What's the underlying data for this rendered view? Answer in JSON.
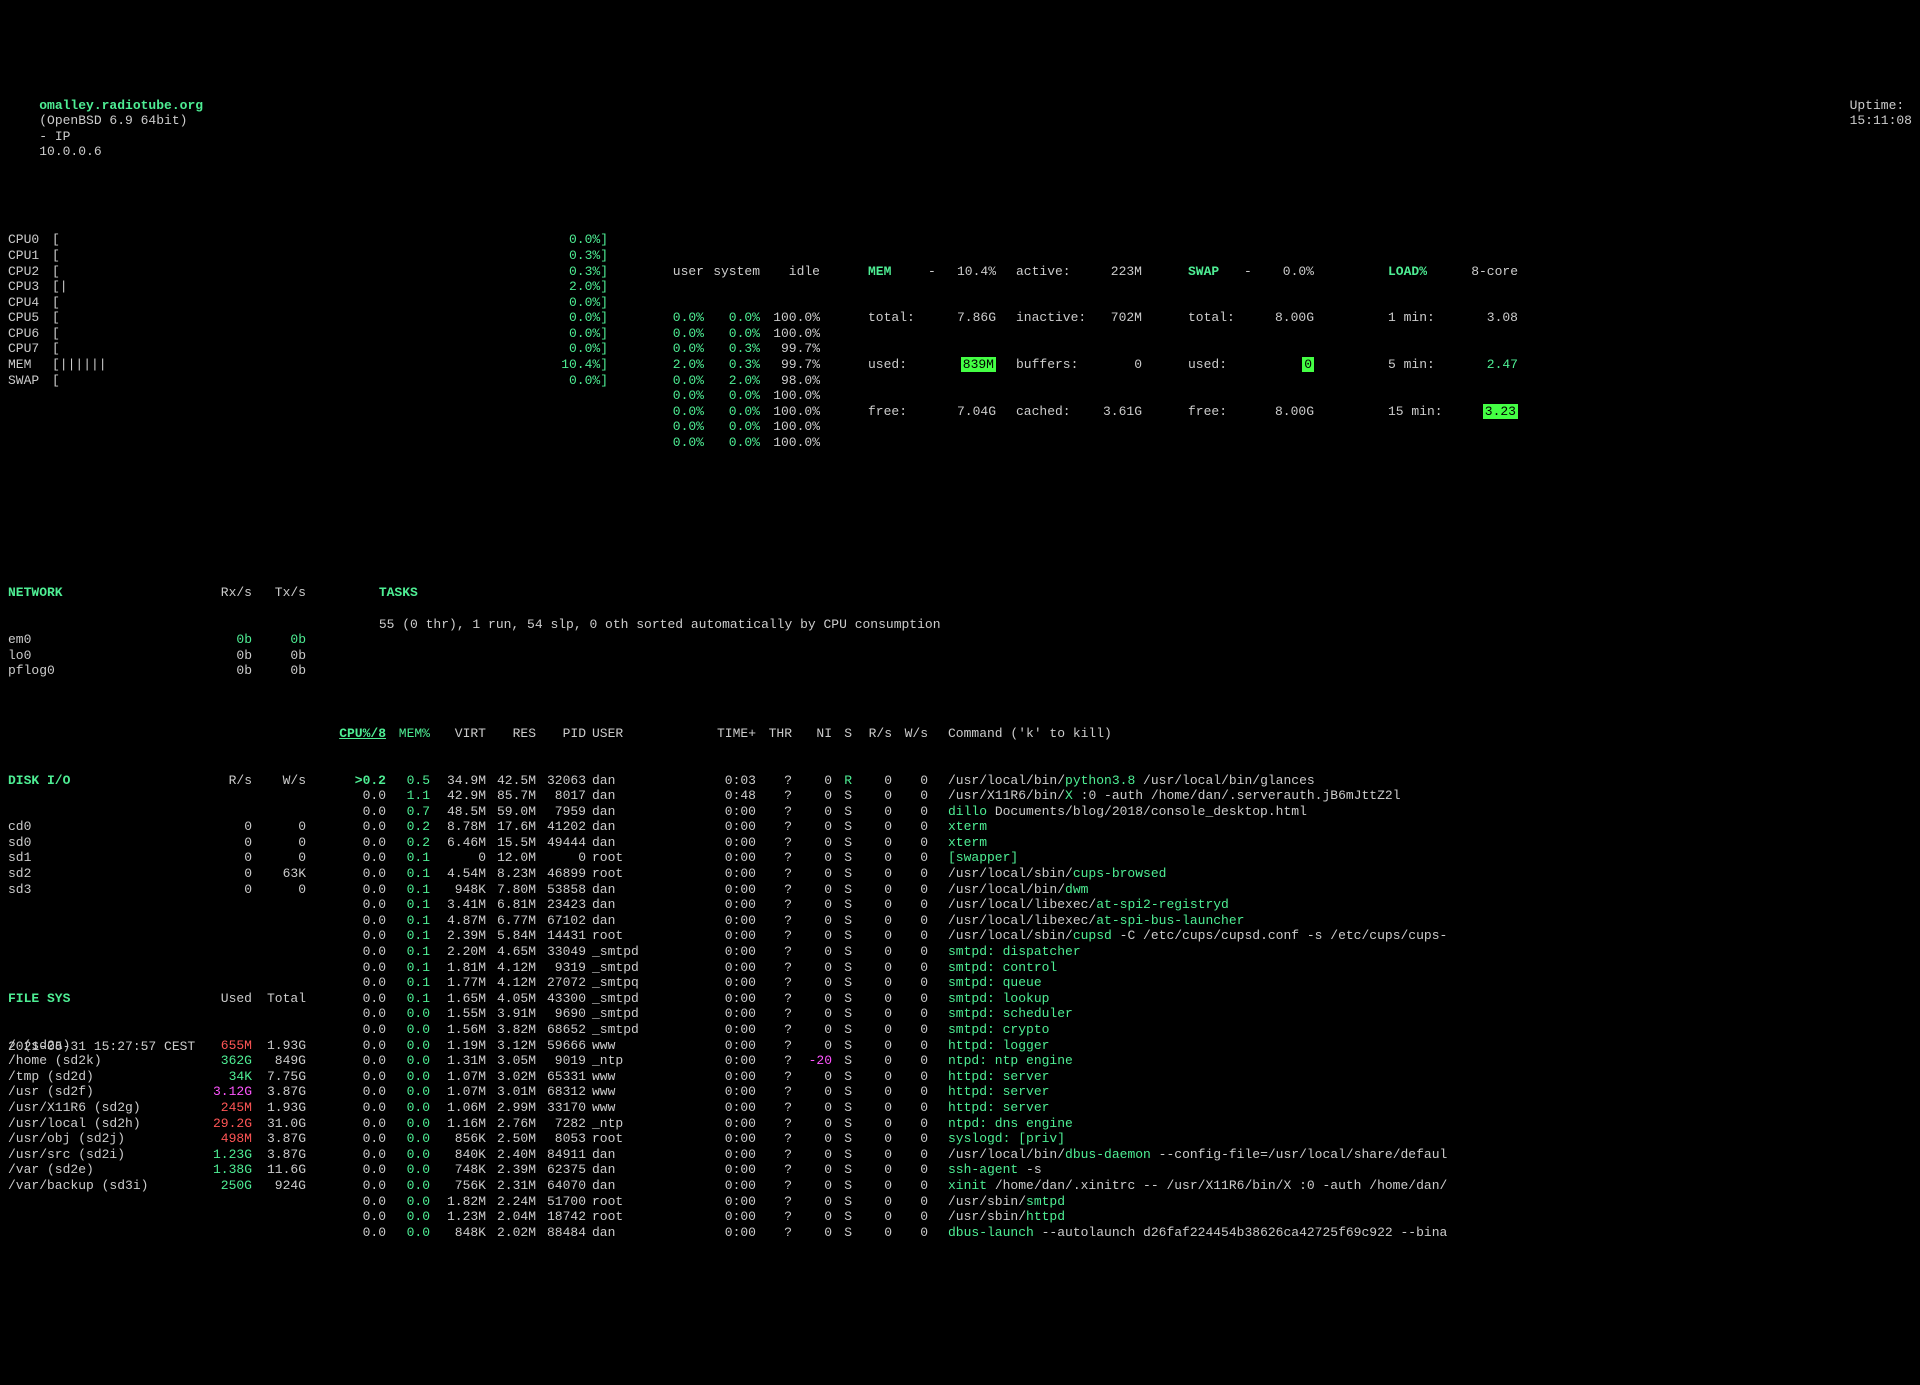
{
  "header": {
    "hostname": "omalley.radiotube.org",
    "os": "(OpenBSD 6.9 64bit)",
    "ip_label": "- IP",
    "ip": "10.0.0.6",
    "uptime_label": "Uptime:",
    "uptime": "15:11:08"
  },
  "cpus": [
    {
      "label": "CPU0",
      "bar": "[",
      "pct": "0.0%]"
    },
    {
      "label": "CPU1",
      "bar": "[",
      "pct": "0.3%]"
    },
    {
      "label": "CPU2",
      "bar": "[",
      "pct": "0.3%]"
    },
    {
      "label": "CPU3",
      "bar": "[|",
      "pct": "2.0%]"
    },
    {
      "label": "CPU4",
      "bar": "[",
      "pct": "0.0%]"
    },
    {
      "label": "CPU5",
      "bar": "[",
      "pct": "0.0%]"
    },
    {
      "label": "CPU6",
      "bar": "[",
      "pct": "0.0%]"
    },
    {
      "label": "CPU7",
      "bar": "[",
      "pct": "0.0%]"
    },
    {
      "label": "MEM ",
      "bar": "[||||||",
      "pct": "10.4%]"
    },
    {
      "label": "SWAP",
      "bar": "[",
      "pct": "0.0%]"
    }
  ],
  "usi_head": {
    "u": "user",
    "s": "system",
    "i": "idle"
  },
  "usi": [
    {
      "u": "0.0%",
      "s": "0.0%",
      "i": "100.0%"
    },
    {
      "u": "0.0%",
      "s": "0.0%",
      "i": "100.0%"
    },
    {
      "u": "0.0%",
      "s": "0.3%",
      "i": "99.7%"
    },
    {
      "u": "2.0%",
      "s": "0.3%",
      "i": "99.7%"
    },
    {
      "u": "0.0%",
      "s": "2.0%",
      "i": "98.0%"
    },
    {
      "u": "0.0%",
      "s": "0.0%",
      "i": "100.0%"
    },
    {
      "u": "0.0%",
      "s": "0.0%",
      "i": "100.0%"
    },
    {
      "u": "0.0%",
      "s": "0.0%",
      "i": "100.0%"
    },
    {
      "u": "0.0%",
      "s": "0.0%",
      "i": "100.0%"
    }
  ],
  "mem": {
    "title": "MEM",
    "dash": "-",
    "pct": "10.4%",
    "active_l": "active:",
    "active_v": "223M",
    "total_l": "total:",
    "total_v": "7.86G",
    "inactive_l": "inactive:",
    "inactive_v": "702M",
    "used_l": "used:",
    "used_v": "839M",
    "buffers_l": "buffers:",
    "buffers_v": "0",
    "free_l": "free:",
    "free_v": "7.04G",
    "cached_l": "cached:",
    "cached_v": "3.61G"
  },
  "swap": {
    "title": "SWAP",
    "dash": "-",
    "pct": "0.0%",
    "total_l": "total:",
    "total_v": "8.00G",
    "used_l": "used:",
    "used_v": "0",
    "free_l": "free:",
    "free_v": "8.00G"
  },
  "load": {
    "title": "LOAD%",
    "core": "8-core",
    "m1_l": "1 min:",
    "m1_v": "3.08",
    "m5_l": "5 min:",
    "m5_v": "2.47",
    "m15_l": "15 min:",
    "m15_v": "3.23"
  },
  "network": {
    "title": "NETWORK",
    "rx": "Rx/s",
    "tx": "Tx/s",
    "rows": [
      {
        "if": "em0",
        "rx": "0b",
        "tx": "0b",
        "c": "green"
      },
      {
        "if": "lo0",
        "rx": "0b",
        "tx": "0b",
        "c": "white"
      },
      {
        "if": "pflog0",
        "rx": "0b",
        "tx": "0b",
        "c": "white"
      }
    ]
  },
  "diskio": {
    "title": "DISK I/O",
    "r": "R/s",
    "w": "W/s",
    "rows": [
      {
        "d": "cd0",
        "r": "0",
        "w": "0"
      },
      {
        "d": "sd0",
        "r": "0",
        "w": "0"
      },
      {
        "d": "sd1",
        "r": "0",
        "w": "0"
      },
      {
        "d": "sd2",
        "r": "0",
        "w": "63K"
      },
      {
        "d": "sd3",
        "r": "0",
        "w": "0"
      }
    ]
  },
  "filesys": {
    "title": "FILE SYS",
    "used": "Used",
    "total": "Total",
    "rows": [
      {
        "p": "/ (sd2a)",
        "u": "655M",
        "t": "1.93G",
        "c": "red"
      },
      {
        "p": "/home (sd2k)",
        "u": "362G",
        "t": "849G",
        "c": "green"
      },
      {
        "p": "/tmp (sd2d)",
        "u": "34K",
        "t": "7.75G",
        "c": "green"
      },
      {
        "p": "/usr (sd2f)",
        "u": "3.12G",
        "t": "3.87G",
        "c": "magenta"
      },
      {
        "p": "/usr/X11R6 (sd2g)",
        "u": "245M",
        "t": "1.93G",
        "c": "red"
      },
      {
        "p": "/usr/local (sd2h)",
        "u": "29.2G",
        "t": "31.0G",
        "c": "red"
      },
      {
        "p": "/usr/obj (sd2j)",
        "u": "498M",
        "t": "3.87G",
        "c": "red"
      },
      {
        "p": "/usr/src (sd2i)",
        "u": "1.23G",
        "t": "3.87G",
        "c": "green"
      },
      {
        "p": "/var (sd2e)",
        "u": "1.38G",
        "t": "11.6G",
        "c": "green"
      },
      {
        "p": "/var/backup (sd3i)",
        "u": "250G",
        "t": "924G",
        "c": "green"
      }
    ]
  },
  "tasks_label": "TASKS",
  "tasks_text": "55 (0 thr), 1 run, 54 slp, 0 oth sorted automatically by CPU consumption",
  "proc_head": {
    "cpu": "CPU%/8",
    "mem": "MEM%",
    "virt": "VIRT",
    "res": "RES",
    "pid": "PID",
    "user": "USER",
    "time": "TIME+",
    "thr": "THR",
    "ni": "NI",
    "s": "S",
    "rs": "R/s",
    "ws": "W/s",
    "cmd": "Command ('k' to kill)"
  },
  "procs": [
    {
      "cpu": ">0.2",
      "mem": "0.5",
      "virt": "34.9M",
      "res": "42.5M",
      "pid": "32063",
      "user": "dan",
      "time": "0:03",
      "thr": "?",
      "ni": "0",
      "s": "R",
      "rs": "0",
      "ws": "0",
      "cmd": [
        {
          "t": "/usr/local/bin/",
          "c": "white"
        },
        {
          "t": "python3.8",
          "c": "green"
        },
        {
          "t": " /usr/local/bin/glances",
          "c": "white"
        }
      ]
    },
    {
      "cpu": "0.0",
      "mem": "1.1",
      "virt": "42.9M",
      "res": "85.7M",
      "pid": "8017",
      "user": "dan",
      "time": "0:48",
      "thr": "?",
      "ni": "0",
      "s": "S",
      "rs": "0",
      "ws": "0",
      "cmd": [
        {
          "t": "/usr/X11R6/bin/",
          "c": "white"
        },
        {
          "t": "X",
          "c": "green"
        },
        {
          "t": " :0 -auth /home/dan/.serverauth.jB6mJttZ2l",
          "c": "white"
        }
      ]
    },
    {
      "cpu": "0.0",
      "mem": "0.7",
      "virt": "48.5M",
      "res": "59.0M",
      "pid": "7959",
      "user": "dan",
      "time": "0:00",
      "thr": "?",
      "ni": "0",
      "s": "S",
      "rs": "0",
      "ws": "0",
      "cmd": [
        {
          "t": "dillo",
          "c": "green"
        },
        {
          "t": " Documents/blog/2018/console_desktop.html",
          "c": "white"
        }
      ]
    },
    {
      "cpu": "0.0",
      "mem": "0.2",
      "virt": "8.78M",
      "res": "17.6M",
      "pid": "41202",
      "user": "dan",
      "time": "0:00",
      "thr": "?",
      "ni": "0",
      "s": "S",
      "rs": "0",
      "ws": "0",
      "cmd": [
        {
          "t": "xterm",
          "c": "green"
        }
      ]
    },
    {
      "cpu": "0.0",
      "mem": "0.2",
      "virt": "6.46M",
      "res": "15.5M",
      "pid": "49444",
      "user": "dan",
      "time": "0:00",
      "thr": "?",
      "ni": "0",
      "s": "S",
      "rs": "0",
      "ws": "0",
      "cmd": [
        {
          "t": "xterm",
          "c": "green"
        }
      ]
    },
    {
      "cpu": "0.0",
      "mem": "0.1",
      "virt": "0",
      "res": "12.0M",
      "pid": "0",
      "user": "root",
      "time": "0:00",
      "thr": "?",
      "ni": "0",
      "s": "S",
      "rs": "0",
      "ws": "0",
      "cmd": [
        {
          "t": "[swapper]",
          "c": "green"
        }
      ]
    },
    {
      "cpu": "0.0",
      "mem": "0.1",
      "virt": "4.54M",
      "res": "8.23M",
      "pid": "46899",
      "user": "root",
      "time": "0:00",
      "thr": "?",
      "ni": "0",
      "s": "S",
      "rs": "0",
      "ws": "0",
      "cmd": [
        {
          "t": "/usr/local/sbin/",
          "c": "white"
        },
        {
          "t": "cups-browsed",
          "c": "green"
        }
      ]
    },
    {
      "cpu": "0.0",
      "mem": "0.1",
      "virt": "948K",
      "res": "7.80M",
      "pid": "53858",
      "user": "dan",
      "time": "0:00",
      "thr": "?",
      "ni": "0",
      "s": "S",
      "rs": "0",
      "ws": "0",
      "cmd": [
        {
          "t": "/usr/local/bin/",
          "c": "white"
        },
        {
          "t": "dwm",
          "c": "green"
        }
      ]
    },
    {
      "cpu": "0.0",
      "mem": "0.1",
      "virt": "3.41M",
      "res": "6.81M",
      "pid": "23423",
      "user": "dan",
      "time": "0:00",
      "thr": "?",
      "ni": "0",
      "s": "S",
      "rs": "0",
      "ws": "0",
      "cmd": [
        {
          "t": "/usr/local/libexec/",
          "c": "white"
        },
        {
          "t": "at-spi2-registryd",
          "c": "green"
        }
      ]
    },
    {
      "cpu": "0.0",
      "mem": "0.1",
      "virt": "4.87M",
      "res": "6.77M",
      "pid": "67102",
      "user": "dan",
      "time": "0:00",
      "thr": "?",
      "ni": "0",
      "s": "S",
      "rs": "0",
      "ws": "0",
      "cmd": [
        {
          "t": "/usr/local/libexec/",
          "c": "white"
        },
        {
          "t": "at-spi-bus-launcher",
          "c": "green"
        }
      ]
    },
    {
      "cpu": "0.0",
      "mem": "0.1",
      "virt": "2.39M",
      "res": "5.84M",
      "pid": "14431",
      "user": "root",
      "time": "0:00",
      "thr": "?",
      "ni": "0",
      "s": "S",
      "rs": "0",
      "ws": "0",
      "cmd": [
        {
          "t": "/usr/local/sbin/",
          "c": "white"
        },
        {
          "t": "cupsd",
          "c": "green"
        },
        {
          "t": " -C /etc/cups/cupsd.conf -s /etc/cups/cups-",
          "c": "white"
        }
      ]
    },
    {
      "cpu": "0.0",
      "mem": "0.1",
      "virt": "2.20M",
      "res": "4.65M",
      "pid": "33049",
      "user": "_smtpd",
      "time": "0:00",
      "thr": "?",
      "ni": "0",
      "s": "S",
      "rs": "0",
      "ws": "0",
      "cmd": [
        {
          "t": "smtpd: dispatcher",
          "c": "green"
        }
      ]
    },
    {
      "cpu": "0.0",
      "mem": "0.1",
      "virt": "1.81M",
      "res": "4.12M",
      "pid": "9319",
      "user": "_smtpd",
      "time": "0:00",
      "thr": "?",
      "ni": "0",
      "s": "S",
      "rs": "0",
      "ws": "0",
      "cmd": [
        {
          "t": "smtpd: control",
          "c": "green"
        }
      ]
    },
    {
      "cpu": "0.0",
      "mem": "0.1",
      "virt": "1.77M",
      "res": "4.12M",
      "pid": "27072",
      "user": "_smtpq",
      "time": "0:00",
      "thr": "?",
      "ni": "0",
      "s": "S",
      "rs": "0",
      "ws": "0",
      "cmd": [
        {
          "t": "smtpd: queue",
          "c": "green"
        }
      ]
    },
    {
      "cpu": "0.0",
      "mem": "0.1",
      "virt": "1.65M",
      "res": "4.05M",
      "pid": "43300",
      "user": "_smtpd",
      "time": "0:00",
      "thr": "?",
      "ni": "0",
      "s": "S",
      "rs": "0",
      "ws": "0",
      "cmd": [
        {
          "t": "smtpd: lookup",
          "c": "green"
        }
      ]
    },
    {
      "cpu": "0.0",
      "mem": "0.0",
      "virt": "1.55M",
      "res": "3.91M",
      "pid": "9690",
      "user": "_smtpd",
      "time": "0:00",
      "thr": "?",
      "ni": "0",
      "s": "S",
      "rs": "0",
      "ws": "0",
      "cmd": [
        {
          "t": "smtpd: scheduler",
          "c": "green"
        }
      ]
    },
    {
      "cpu": "0.0",
      "mem": "0.0",
      "virt": "1.56M",
      "res": "3.82M",
      "pid": "68652",
      "user": "_smtpd",
      "time": "0:00",
      "thr": "?",
      "ni": "0",
      "s": "S",
      "rs": "0",
      "ws": "0",
      "cmd": [
        {
          "t": "smtpd: crypto",
          "c": "green"
        }
      ]
    },
    {
      "cpu": "0.0",
      "mem": "0.0",
      "virt": "1.19M",
      "res": "3.12M",
      "pid": "59666",
      "user": "www",
      "time": "0:00",
      "thr": "?",
      "ni": "0",
      "s": "S",
      "rs": "0",
      "ws": "0",
      "cmd": [
        {
          "t": "httpd: logger",
          "c": "green"
        }
      ]
    },
    {
      "cpu": "0.0",
      "mem": "0.0",
      "virt": "1.31M",
      "res": "3.05M",
      "pid": "9019",
      "user": "_ntp",
      "time": "0:00",
      "thr": "?",
      "ni": "-20",
      "nic": "magenta",
      "s": "S",
      "rs": "0",
      "ws": "0",
      "cmd": [
        {
          "t": "ntpd: ntp engine",
          "c": "green"
        }
      ]
    },
    {
      "cpu": "0.0",
      "mem": "0.0",
      "virt": "1.07M",
      "res": "3.02M",
      "pid": "65331",
      "user": "www",
      "time": "0:00",
      "thr": "?",
      "ni": "0",
      "s": "S",
      "rs": "0",
      "ws": "0",
      "cmd": [
        {
          "t": "httpd: server",
          "c": "green"
        }
      ]
    },
    {
      "cpu": "0.0",
      "mem": "0.0",
      "virt": "1.07M",
      "res": "3.01M",
      "pid": "68312",
      "user": "www",
      "time": "0:00",
      "thr": "?",
      "ni": "0",
      "s": "S",
      "rs": "0",
      "ws": "0",
      "cmd": [
        {
          "t": "httpd: server",
          "c": "green"
        }
      ]
    },
    {
      "cpu": "0.0",
      "mem": "0.0",
      "virt": "1.06M",
      "res": "2.99M",
      "pid": "33170",
      "user": "www",
      "time": "0:00",
      "thr": "?",
      "ni": "0",
      "s": "S",
      "rs": "0",
      "ws": "0",
      "cmd": [
        {
          "t": "httpd: server",
          "c": "green"
        }
      ]
    },
    {
      "cpu": "0.0",
      "mem": "0.0",
      "virt": "1.16M",
      "res": "2.76M",
      "pid": "7282",
      "user": "_ntp",
      "time": "0:00",
      "thr": "?",
      "ni": "0",
      "s": "S",
      "rs": "0",
      "ws": "0",
      "cmd": [
        {
          "t": "ntpd: dns engine",
          "c": "green"
        }
      ]
    },
    {
      "cpu": "0.0",
      "mem": "0.0",
      "virt": "856K",
      "res": "2.50M",
      "pid": "8053",
      "user": "root",
      "time": "0:00",
      "thr": "?",
      "ni": "0",
      "s": "S",
      "rs": "0",
      "ws": "0",
      "cmd": [
        {
          "t": "syslogd: [priv]",
          "c": "green"
        }
      ]
    },
    {
      "cpu": "0.0",
      "mem": "0.0",
      "virt": "840K",
      "res": "2.40M",
      "pid": "84911",
      "user": "dan",
      "time": "0:00",
      "thr": "?",
      "ni": "0",
      "s": "S",
      "rs": "0",
      "ws": "0",
      "cmd": [
        {
          "t": "/usr/local/bin/",
          "c": "white"
        },
        {
          "t": "dbus-daemon",
          "c": "green"
        },
        {
          "t": " --config-file=/usr/local/share/defaul",
          "c": "white"
        }
      ]
    },
    {
      "cpu": "0.0",
      "mem": "0.0",
      "virt": "748K",
      "res": "2.39M",
      "pid": "62375",
      "user": "dan",
      "time": "0:00",
      "thr": "?",
      "ni": "0",
      "s": "S",
      "rs": "0",
      "ws": "0",
      "cmd": [
        {
          "t": "ssh-agent",
          "c": "green"
        },
        {
          "t": " -s",
          "c": "white"
        }
      ]
    },
    {
      "cpu": "0.0",
      "mem": "0.0",
      "virt": "756K",
      "res": "2.31M",
      "pid": "64070",
      "user": "dan",
      "time": "0:00",
      "thr": "?",
      "ni": "0",
      "s": "S",
      "rs": "0",
      "ws": "0",
      "cmd": [
        {
          "t": "xinit",
          "c": "green"
        },
        {
          "t": " /home/dan/.xinitrc -- /usr/X11R6/bin/X :0 -auth /home/dan/",
          "c": "white"
        }
      ]
    },
    {
      "cpu": "0.0",
      "mem": "0.0",
      "virt": "1.82M",
      "res": "2.24M",
      "pid": "51700",
      "user": "root",
      "time": "0:00",
      "thr": "?",
      "ni": "0",
      "s": "S",
      "rs": "0",
      "ws": "0",
      "cmd": [
        {
          "t": "/usr/sbin/",
          "c": "white"
        },
        {
          "t": "smtpd",
          "c": "green"
        }
      ]
    },
    {
      "cpu": "0.0",
      "mem": "0.0",
      "virt": "1.23M",
      "res": "2.04M",
      "pid": "18742",
      "user": "root",
      "time": "0:00",
      "thr": "?",
      "ni": "0",
      "s": "S",
      "rs": "0",
      "ws": "0",
      "cmd": [
        {
          "t": "/usr/sbin/",
          "c": "white"
        },
        {
          "t": "httpd",
          "c": "green"
        }
      ]
    },
    {
      "cpu": "0.0",
      "mem": "0.0",
      "virt": "848K",
      "res": "2.02M",
      "pid": "88484",
      "user": "dan",
      "time": "0:00",
      "thr": "?",
      "ni": "0",
      "s": "S",
      "rs": "0",
      "ws": "0",
      "cmd": [
        {
          "t": "dbus-launch",
          "c": "green"
        },
        {
          "t": " --autolaunch d26faf224454b38626ca42725f69c922 --bina",
          "c": "white"
        }
      ]
    }
  ],
  "footer": "2021-05-31 15:27:57 CEST"
}
